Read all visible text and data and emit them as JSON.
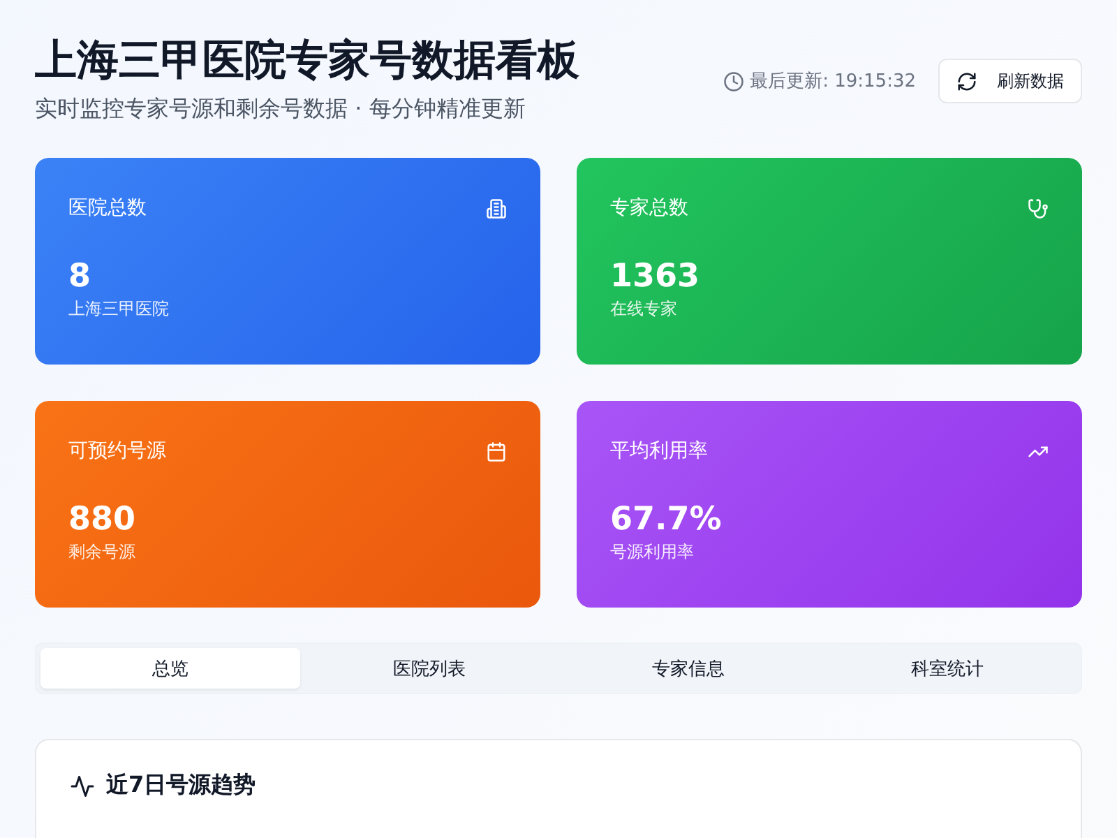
{
  "header": {
    "title": "上海三甲医院专家号数据看板",
    "subtitle": "实时监控专家号源和剩余号数据 · 每分钟精准更新",
    "last_updated": "最后更新: 19:15:32",
    "refresh_button": "刷新数据"
  },
  "stats": [
    {
      "kind": "hospital",
      "label": "医院总数",
      "value": "8",
      "caption": "上海三甲医院"
    },
    {
      "kind": "doctor",
      "label": "专家总数",
      "value": "1363",
      "caption": "在线专家"
    },
    {
      "kind": "calendar",
      "label": "可预约号源",
      "value": "880",
      "caption": "剩余号源"
    },
    {
      "kind": "trend",
      "label": "平均利用率",
      "value": "67.7%",
      "caption": "号源利用率"
    }
  ],
  "tabs": [
    {
      "label": "总览",
      "selected": true
    },
    {
      "label": "医院列表",
      "selected": false
    },
    {
      "label": "专家信息",
      "selected": false
    },
    {
      "label": "科室统计",
      "selected": false
    }
  ],
  "panel": {
    "title": "近7日号源趋势"
  }
}
